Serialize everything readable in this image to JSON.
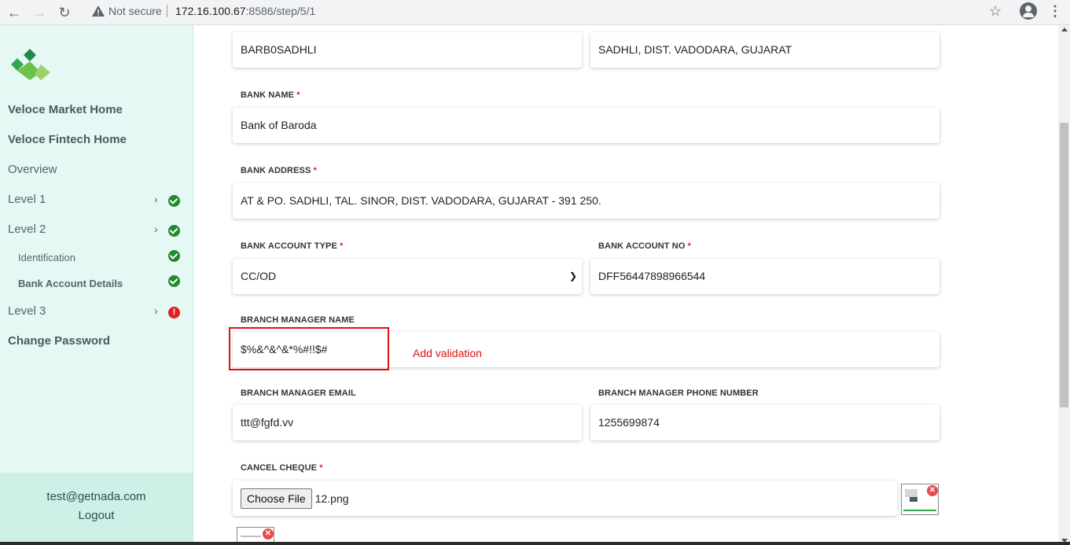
{
  "browser": {
    "security_label": "Not secure",
    "url_host": "172.16.100.67",
    "url_path": ":8586/step/5/1"
  },
  "sidebar": {
    "items": [
      {
        "label": "Veloce Market Home"
      },
      {
        "label": "Veloce Fintech Home"
      },
      {
        "label": "Overview"
      },
      {
        "label": "Level 1",
        "status": "complete"
      },
      {
        "label": "Level 2",
        "status": "complete"
      },
      {
        "label": "Identification",
        "status": "complete"
      },
      {
        "label": "Bank Account Details",
        "status": "complete"
      },
      {
        "label": "Level 3",
        "status": "error",
        "status_glyph": "!"
      },
      {
        "label": "Change Password"
      }
    ],
    "footer": {
      "email": "test@getnada.com",
      "logout": "Logout"
    }
  },
  "form": {
    "ifsc_value": "BARB0SADHLI",
    "branch_value": "SADHLI, DIST. VADODARA, GUJARAT",
    "bank_name": {
      "label": "BANK NAME",
      "required": "*",
      "value": "Bank of Baroda"
    },
    "bank_address": {
      "label": "BANK ADDRESS",
      "required": "*",
      "value": "AT & PO. SADHLI, TAL. SINOR, DIST. VADODARA, GUJARAT - 391 250."
    },
    "account_type": {
      "label": "BANK ACCOUNT TYPE",
      "required": "*",
      "value": "CC/OD"
    },
    "account_no": {
      "label": "BANK ACCOUNT NO",
      "required": "*",
      "value": "DFF56447898966544"
    },
    "manager_name": {
      "label": "BRANCH MANAGER NAME",
      "value": "$%&^&^&*%#!!$#"
    },
    "manager_email": {
      "label": "BRANCH MANAGER EMAIL",
      "value": "ttt@fgfd.vv"
    },
    "manager_phone": {
      "label": "BRANCH MANAGER PHONE NUMBER",
      "value": "1255699874"
    },
    "cancel_cheque": {
      "label": "CANCEL CHEQUE",
      "required": "*",
      "button": "Choose File",
      "file_name": "12.png"
    }
  },
  "annotation": {
    "text": "Add validation",
    "color": "#e01010"
  },
  "colors": {
    "sidebar_bg": "#e6f8f3",
    "success": "#1f8a2f",
    "error": "#e02020",
    "logo_green": "#2fa84f"
  }
}
